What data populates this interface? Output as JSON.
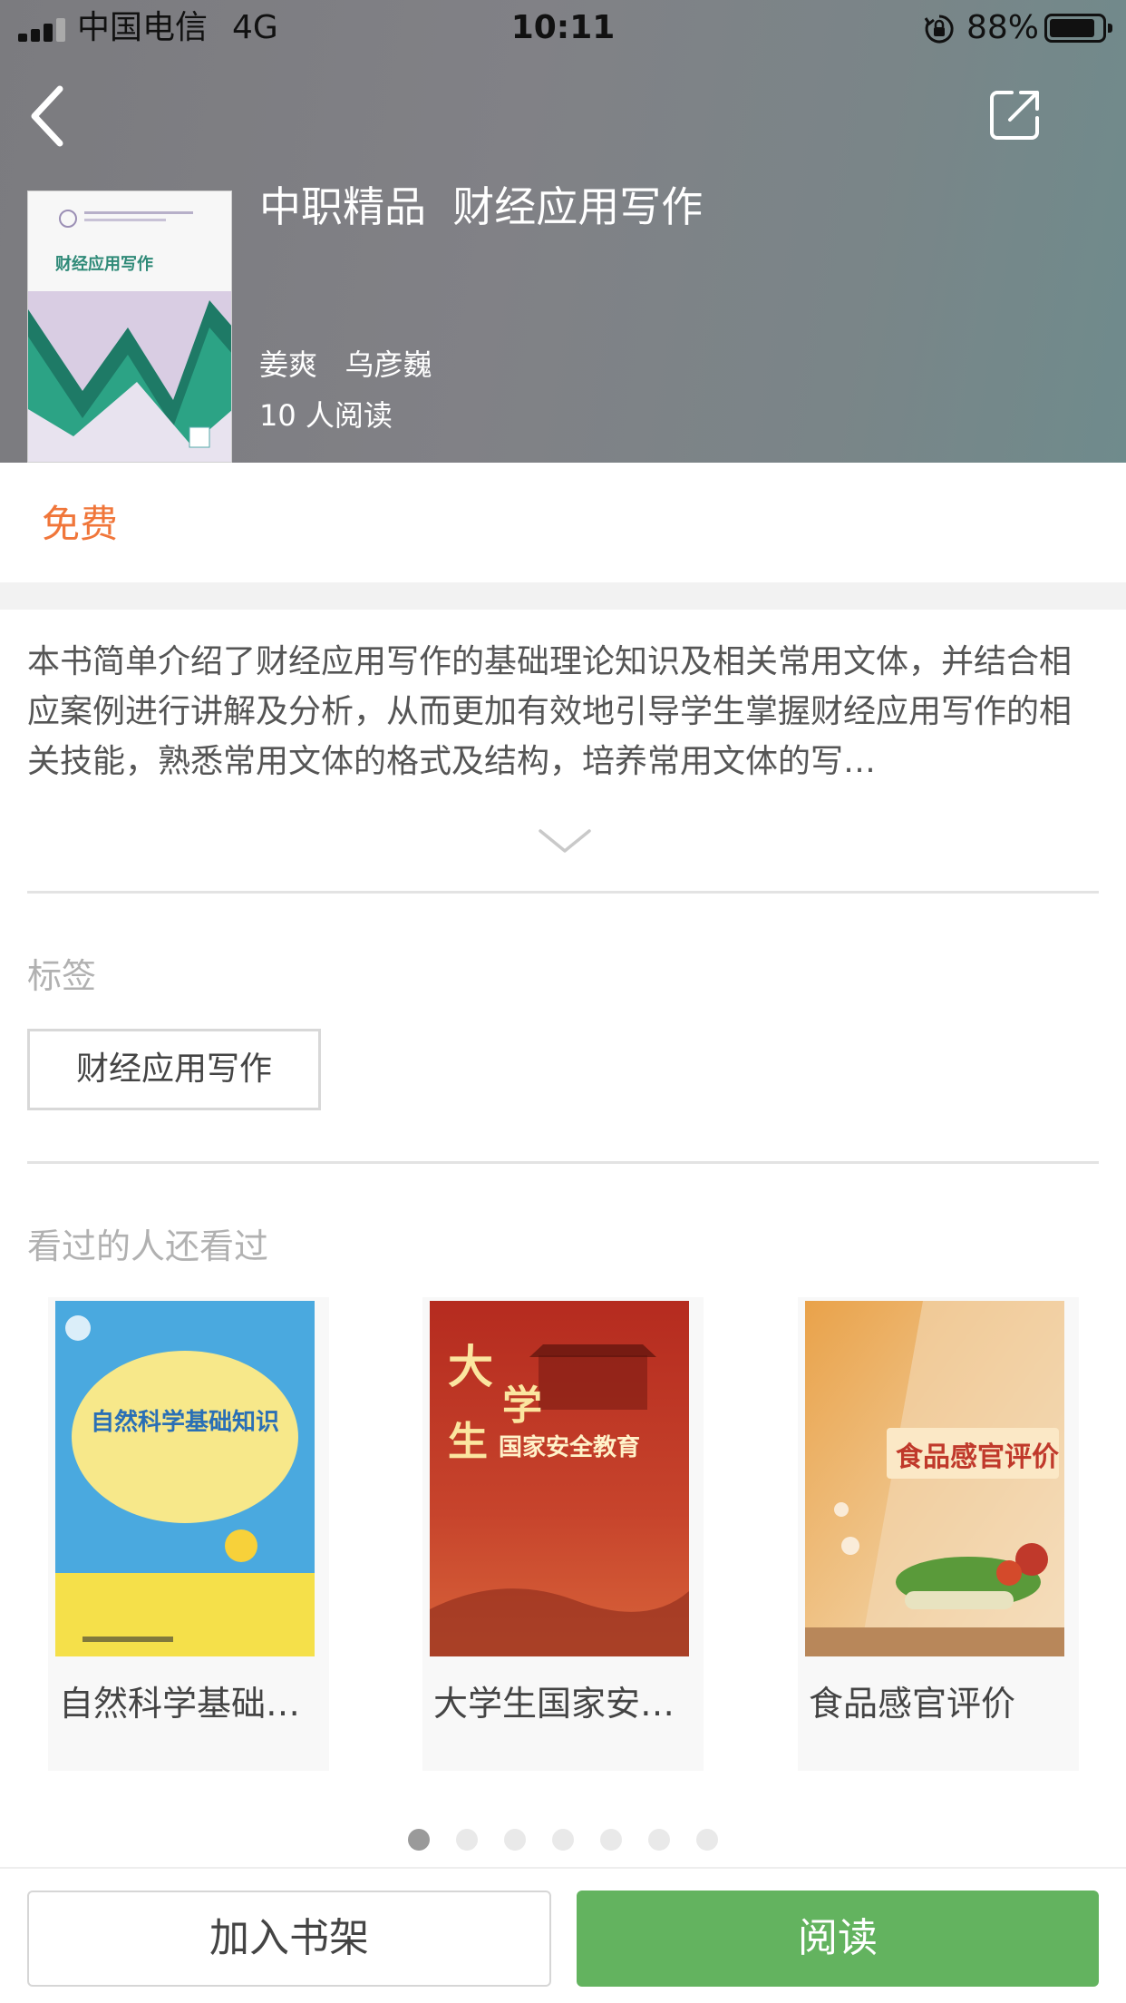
{
  "status_bar": {
    "carrier": "中国电信",
    "network": "4G",
    "time": "10:11",
    "battery_percent": "88%",
    "battery_level": 0.88,
    "icons": [
      "signal-icon",
      "orientation-lock-icon",
      "battery-icon"
    ]
  },
  "nav": {
    "back_icon": "chevron-left-icon",
    "share_icon": "share-icon"
  },
  "book": {
    "title": "中职精品  财经应用写作",
    "authors": "姜爽   乌彦巍",
    "readers": "10 人阅读",
    "cover_title": "财经应用写作"
  },
  "price": "免费",
  "description": "本书简单介绍了财经应用写作的基础理论知识及相关常用文体，并结合相应案例进行讲解及分析，从而更加有效地引导学生掌握财经应用写作的相关技能，熟悉常用文体的格式及结构，培养常用文体的写…",
  "expand_icon": "chevron-down-icon",
  "tags": {
    "heading": "标签",
    "items": [
      "财经应用写作"
    ]
  },
  "recommendations": {
    "heading": "看过的人还看过",
    "items": [
      {
        "title": "自然科学基础…",
        "cover_text": "自然科学基础知识",
        "cover_colors": [
          "#4aa9df",
          "#f5e04a"
        ]
      },
      {
        "title": "大学生国家安…",
        "cover_text": "大学生 国家安全教育",
        "cover_colors": [
          "#b52b1f",
          "#d8643a"
        ]
      },
      {
        "title": "食品感官评价",
        "cover_text": "食品感官评价",
        "cover_colors": [
          "#e9a24a",
          "#f6e6c8"
        ]
      }
    ]
  },
  "pager": {
    "count": 7,
    "active": 0
  },
  "actions": {
    "add_shelf": "加入书架",
    "read": "阅读"
  },
  "colors": {
    "accent_price": "#f0763a",
    "read_button": "#63b35f"
  }
}
